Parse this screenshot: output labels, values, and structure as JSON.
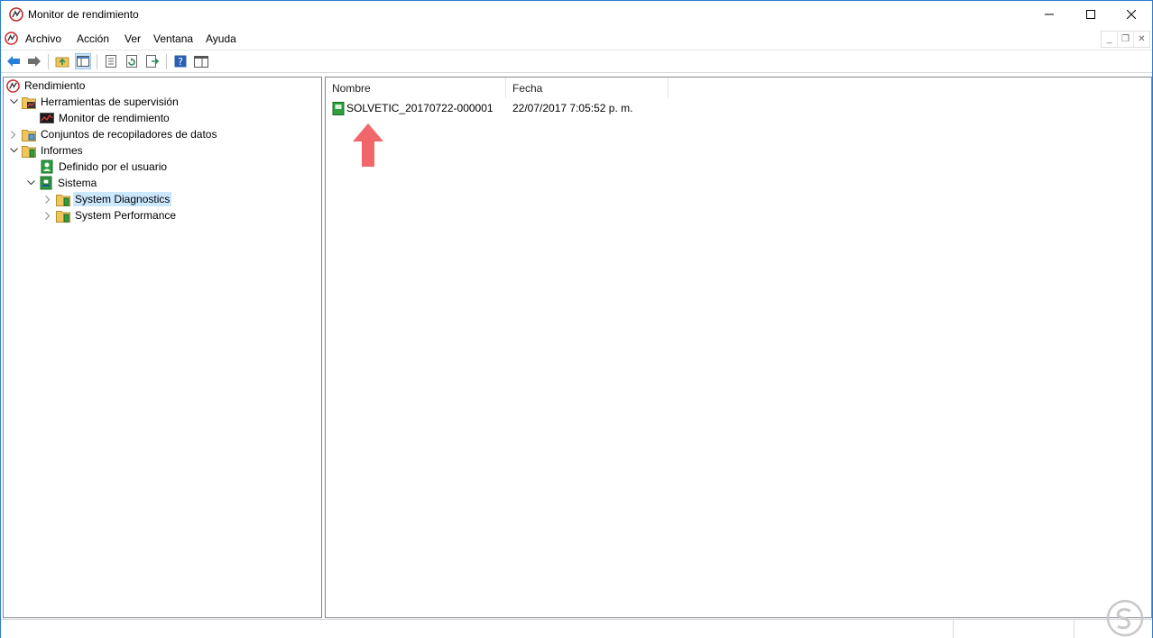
{
  "window": {
    "title": "Monitor de rendimiento"
  },
  "menu": {
    "items": [
      "Archivo",
      "Acción",
      "Ver",
      "Ventana",
      "Ayuda"
    ]
  },
  "toolbar": {
    "buttons": [
      "back-icon",
      "forward-icon",
      "up-folder-icon",
      "show-hide-tree-icon",
      "properties-icon",
      "refresh-icon",
      "export-icon",
      "help-icon",
      "view-icon"
    ]
  },
  "tree": {
    "root": "Rendimiento",
    "items": [
      {
        "label": "Herramientas de supervisión"
      },
      {
        "label": "Monitor de rendimiento"
      },
      {
        "label": "Conjuntos de recopiladores de datos"
      },
      {
        "label": "Informes"
      },
      {
        "label": "Definido por el usuario"
      },
      {
        "label": "Sistema"
      },
      {
        "label": "System Diagnostics"
      },
      {
        "label": "System Performance"
      }
    ],
    "selected": "System Diagnostics"
  },
  "list": {
    "columns": [
      "Nombre",
      "Fecha"
    ],
    "rows": [
      {
        "name": "SOLVETIC_20170722-000001",
        "date": "22/07/2017 7:05:52 p. m."
      }
    ]
  },
  "colors": {
    "accent": "#2b7bd1",
    "selection": "#cce8ff",
    "arrow": "#f0666a"
  }
}
